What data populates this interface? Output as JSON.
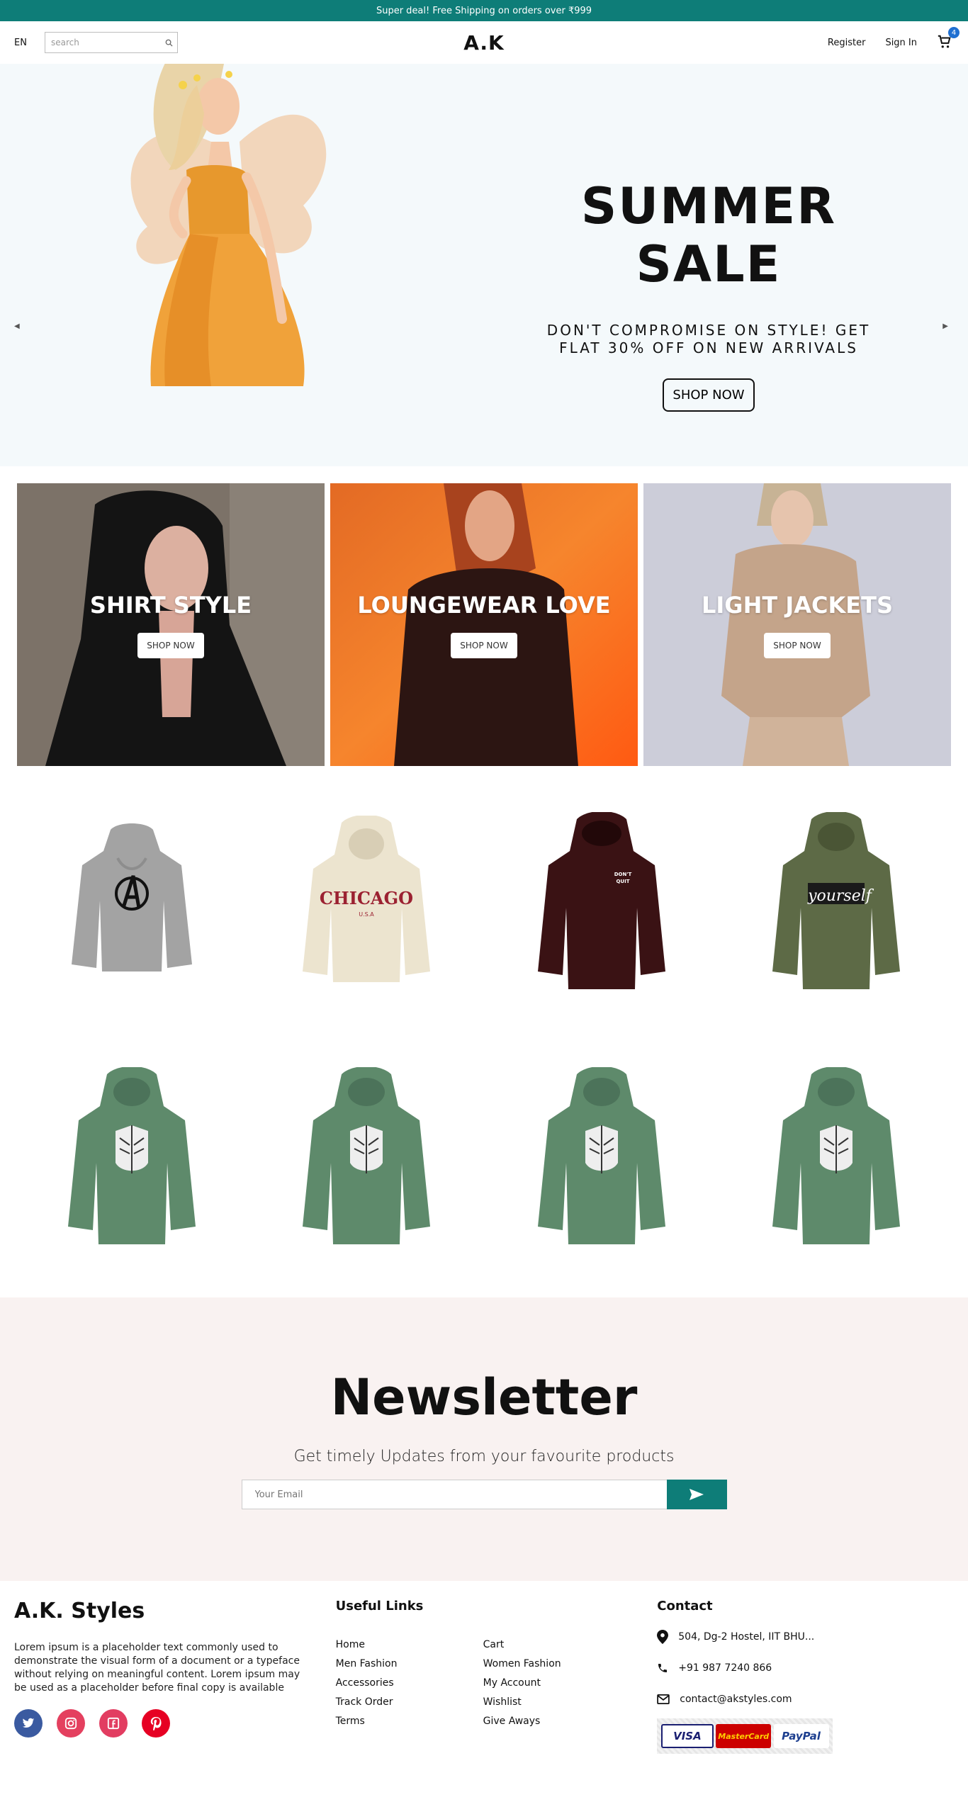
{
  "announcement": "Super deal! Free Shipping on orders over ₹999",
  "header": {
    "lang": "EN",
    "search_placeholder": "search",
    "logo": "A.K",
    "register": "Register",
    "signin": "Sign In",
    "cart_count": "4"
  },
  "hero": {
    "title": "SUMMER SALE",
    "subtitle": "DON'T COMPROMISE ON STYLE! GET FLAT 30% OFF ON NEW ARRIVALS",
    "button": "SHOP NOW"
  },
  "categories": [
    {
      "title": "SHIRT STYLE",
      "button": "SHOP NOW"
    },
    {
      "title": "LOUNGEWEAR LOVE",
      "button": "SHOP NOW"
    },
    {
      "title": "LIGHT JACKETS",
      "button": "SHOP NOW"
    }
  ],
  "products": [
    {
      "name": "grey-avengers-hoodie",
      "color": "#a3a3a3",
      "print": "A"
    },
    {
      "name": "cream-chicago-hoodie",
      "color": "#ece4cf",
      "print": "CHICAGO"
    },
    {
      "name": "maroon-dont-quit-hoodie",
      "color": "#3a1214",
      "print": "DON'T QUIT"
    },
    {
      "name": "olive-be-yourself-hoodie",
      "color": "#5d6a46",
      "print": "yourself"
    },
    {
      "name": "green-wings-hoodie",
      "color": "#5e8a6b",
      "print": ""
    },
    {
      "name": "green-wings-hoodie",
      "color": "#5e8a6b",
      "print": ""
    },
    {
      "name": "green-wings-hoodie",
      "color": "#5e8a6b",
      "print": ""
    },
    {
      "name": "green-wings-hoodie",
      "color": "#5e8a6b",
      "print": ""
    }
  ],
  "newsletter": {
    "title": "Newsletter",
    "subtitle": "Get timely Updates from your favourite products",
    "placeholder": "Your Email"
  },
  "footer": {
    "brand": "A.K. Styles",
    "description": "Lorem ipsum is a placeholder text commonly used to demonstrate the visual form of a document or a typeface without relying on meaningful content. Lorem ipsum may be used as a placeholder before final copy is available",
    "useful_links_title": "Useful Links",
    "links": [
      "Home",
      "Cart",
      "Men Fashion",
      "Women Fashion",
      "Accessories",
      "My Account",
      "Track Order",
      "Wishlist",
      "Terms",
      "Give Aways"
    ],
    "contact_title": "Contact",
    "address": "504, Dg-2 Hostel, IIT BHU...",
    "phone": "+91 987 7240 866",
    "email": "contact@akstyles.com",
    "payments": [
      "VISA",
      "MasterCard",
      "PayPal"
    ]
  },
  "colors": {
    "accent": "#0e7d78",
    "hero_bg": "#f4f9fb",
    "newsletter_bg": "#f9f2f1",
    "cart_badge": "#1f6fd1"
  }
}
